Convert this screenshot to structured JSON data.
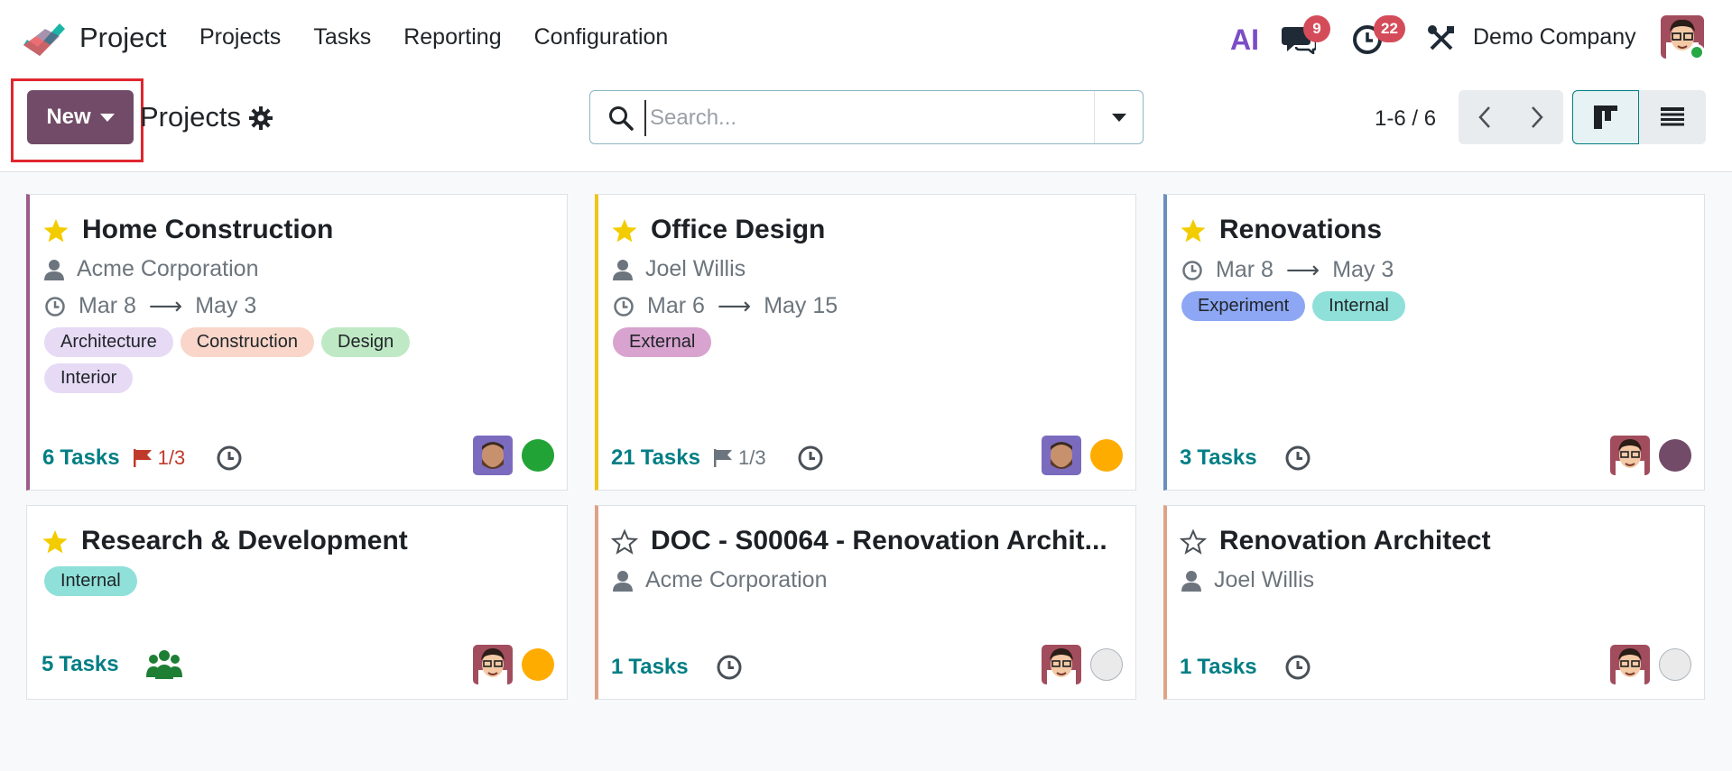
{
  "app": {
    "name": "Project",
    "brand_color": "#714b67"
  },
  "nav": {
    "items": [
      "Projects",
      "Tasks",
      "Reporting",
      "Configuration"
    ]
  },
  "systray": {
    "ai_label": "AI",
    "messages_count": "9",
    "activities_count": "22",
    "company": "Demo Company"
  },
  "control": {
    "new_label": "New",
    "breadcrumb": "Projects",
    "search_placeholder": "Search...",
    "pager": "1-6 / 6"
  },
  "colors": {
    "tag_architecture": "#e6daf5",
    "tag_construction": "#f9d6c9",
    "tag_design": "#bfe9c4",
    "tag_interior": "#e6daf5",
    "tag_external": "#d8a3cf",
    "tag_experiment": "#8da7f5",
    "tag_internal": "#8fe0d9",
    "status_green": "#21a336",
    "status_orange": "#ffac00",
    "status_purple": "#714b67",
    "status_grey": "#eaeaea"
  },
  "cards": [
    {
      "title": "Home Construction",
      "favorite": true,
      "customer": "Acme Corporation",
      "date_start": "Mar 8",
      "date_end": "May 3",
      "tags": [
        "Architecture",
        "Construction",
        "Design",
        "Interior"
      ],
      "tasks_count": "6",
      "tasks_label": "Tasks",
      "milestone": "1/3",
      "status": "green"
    },
    {
      "title": "Office Design",
      "favorite": true,
      "customer": "Joel Willis",
      "date_start": "Mar 6",
      "date_end": "May 15",
      "tags": [
        "External"
      ],
      "tasks_count": "21",
      "tasks_label": "Tasks",
      "milestone": "1/3",
      "status": "orange"
    },
    {
      "title": "Renovations",
      "favorite": true,
      "date_start": "Mar 8",
      "date_end": "May 3",
      "tags": [
        "Experiment",
        "Internal"
      ],
      "tasks_count": "3",
      "tasks_label": "Tasks",
      "status": "purple"
    },
    {
      "title": "Research & Development",
      "favorite": true,
      "tags": [
        "Internal"
      ],
      "tasks_count": "5",
      "tasks_label": "Tasks",
      "status": "orange"
    },
    {
      "title": "DOC - S00064 - Renovation Archit...",
      "favorite": false,
      "customer": "Acme Corporation",
      "tasks_count": "1",
      "tasks_label": "Tasks",
      "status": "grey"
    },
    {
      "title": "Renovation Architect",
      "favorite": false,
      "customer": "Joel Willis",
      "tasks_count": "1",
      "tasks_label": "Tasks",
      "status": "grey"
    }
  ]
}
